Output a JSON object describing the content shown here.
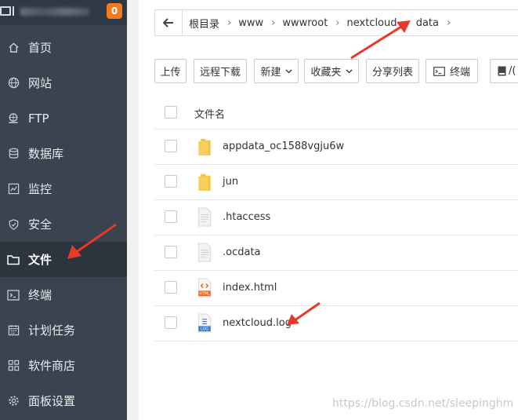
{
  "sidebar": {
    "badge": "0",
    "items": [
      {
        "label": "首页",
        "icon": "home-icon"
      },
      {
        "label": "网站",
        "icon": "globe-icon"
      },
      {
        "label": "FTP",
        "icon": "ftp-icon"
      },
      {
        "label": "数据库",
        "icon": "database-icon"
      },
      {
        "label": "监控",
        "icon": "monitor-icon"
      },
      {
        "label": "安全",
        "icon": "shield-icon"
      },
      {
        "label": "文件",
        "icon": "folder-icon",
        "active": true
      },
      {
        "label": "终端",
        "icon": "terminal-icon"
      },
      {
        "label": "计划任务",
        "icon": "calendar-icon"
      },
      {
        "label": "软件商店",
        "icon": "apps-icon"
      },
      {
        "label": "面板设置",
        "icon": "gear-icon"
      }
    ]
  },
  "breadcrumb": [
    "根目录",
    "www",
    "wwwroot",
    "nextcloud",
    "data"
  ],
  "toolbar": {
    "upload": "上传",
    "remote_download": "远程下载",
    "new": "新建",
    "favorites": "收藏夹",
    "share_list": "分享列表",
    "terminal": "终端",
    "cut_off": "/("
  },
  "table": {
    "header_name": "文件名",
    "rows": [
      {
        "name": "appdata_oc1588vgju6w",
        "type": "folder"
      },
      {
        "name": "jun",
        "type": "folder"
      },
      {
        "name": ".htaccess",
        "type": "file"
      },
      {
        "name": ".ocdata",
        "type": "file"
      },
      {
        "name": "index.html",
        "type": "html"
      },
      {
        "name": "nextcloud.log",
        "type": "log"
      }
    ]
  },
  "icon_labels": {
    "html": "HTML",
    "log": "LOG"
  },
  "colors": {
    "sidebar_bg": "#3a4451",
    "badge": "#f27b1f",
    "annotation_arrow": "#e8382a",
    "folder": "#f5c342"
  },
  "watermark": "https://blog.csdn.net/sleepinghm"
}
